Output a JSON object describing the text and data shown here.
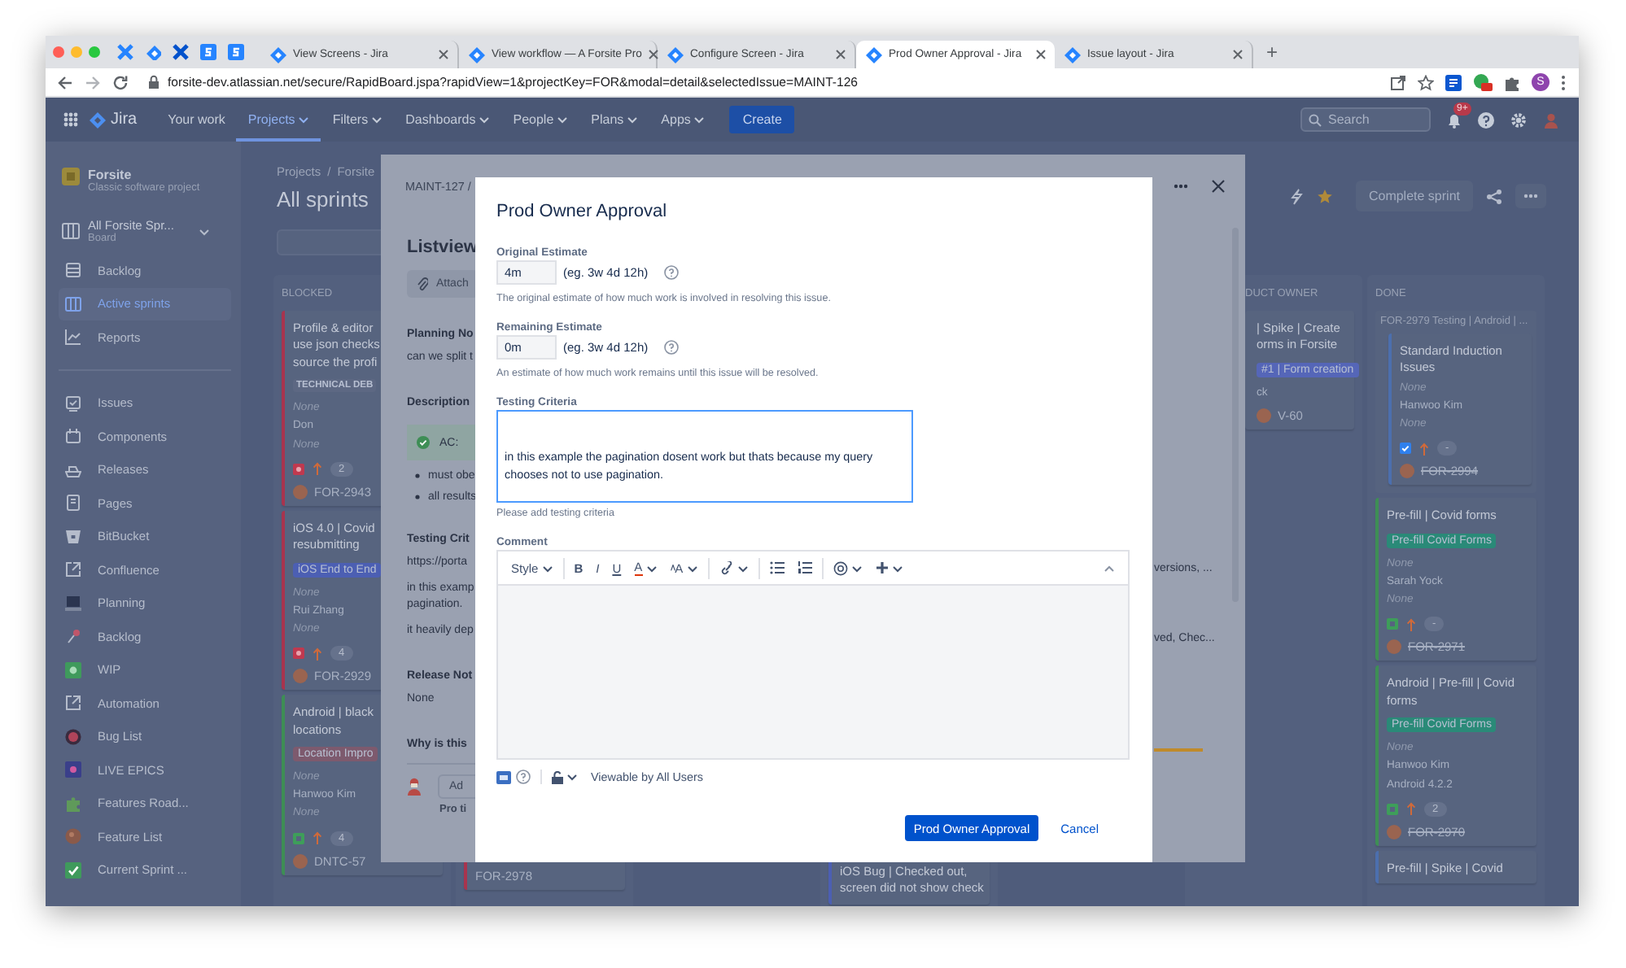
{
  "browser": {
    "tabs": [
      {
        "title": "View Screens - Jira",
        "selected": false
      },
      {
        "title": "View workflow — A Forsite Pro",
        "selected": false
      },
      {
        "title": "Configure Screen - Jira",
        "selected": false
      },
      {
        "title": "Prod Owner Approval - Jira",
        "selected": true
      },
      {
        "title": "Issue layout - Jira",
        "selected": false
      }
    ],
    "new_tab": "+",
    "url": "forsite-dev.atlassian.net/secure/RapidBoard.jspa?rapidView=1&projectKey=FOR&modal=detail&selectedIssue=MAINT-126",
    "profile_initial": "S"
  },
  "nav": {
    "product": "Jira",
    "items": [
      {
        "label": "Your work",
        "selected": false,
        "dropdown": false
      },
      {
        "label": "Projects",
        "selected": true,
        "dropdown": true
      },
      {
        "label": "Filters",
        "selected": false,
        "dropdown": true
      },
      {
        "label": "Dashboards",
        "selected": false,
        "dropdown": true
      },
      {
        "label": "People",
        "selected": false,
        "dropdown": true
      },
      {
        "label": "Plans",
        "selected": false,
        "dropdown": true
      },
      {
        "label": "Apps",
        "selected": false,
        "dropdown": true
      }
    ],
    "create": "Create",
    "search": {
      "placeholder": "Search"
    },
    "notifications": "9+"
  },
  "sidebar": {
    "project": {
      "name": "Forsite",
      "type": "Classic software project"
    },
    "board": {
      "name": "All Forsite Spr...",
      "type": "Board"
    },
    "items": [
      {
        "label": "Backlog",
        "kind": "backlog",
        "selected": false
      },
      {
        "label": "Active sprints",
        "kind": "board",
        "selected": true
      },
      {
        "label": "Reports",
        "kind": "chart",
        "selected": false
      }
    ],
    "shortcuts": [
      {
        "label": "Issues",
        "kind": "issues"
      },
      {
        "label": "Components",
        "kind": "components"
      },
      {
        "label": "Releases",
        "kind": "ship"
      },
      {
        "label": "Pages",
        "kind": "page"
      },
      {
        "label": "BitBucket",
        "kind": "bucket"
      },
      {
        "label": "Confluence",
        "kind": "external"
      },
      {
        "label": "Planning",
        "kind": "laptop"
      },
      {
        "label": "Backlog",
        "kind": "pin"
      },
      {
        "label": "WIP",
        "kind": "green-tile"
      },
      {
        "label": "Automation",
        "kind": "external"
      },
      {
        "label": "Bug List",
        "kind": "red-disc"
      },
      {
        "label": "LIVE EPICS",
        "kind": "purple-tile"
      },
      {
        "label": "Features Road...",
        "kind": "puzzle"
      },
      {
        "label": "Feature List",
        "kind": "brown-disc"
      },
      {
        "label": "Current Sprint ...",
        "kind": "check-tile"
      }
    ]
  },
  "board": {
    "breadcrumb": [
      "Projects",
      "Forsite"
    ],
    "separator": "/",
    "title": "All sprints",
    "complete_sprint": "Complete sprint",
    "columns": [
      {
        "title": "BLOCKED",
        "cards": [
          {
            "summary": "Profile & editor\nuse json checks\nsource the profi",
            "color": "#a8344e",
            "tag": {
              "text": "TECHNICAL DEB",
              "color": "#5d6883"
            },
            "fields": [
              {
                "text": "None",
                "empty": true
              },
              {
                "text": "Don",
                "empty": false
              },
              {
                "text": "None",
                "empty": true
              }
            ],
            "kind": "bug",
            "estimate": "2",
            "key": "FOR-2943",
            "done": false
          },
          {
            "summary": "iOS 4.0 | Covid\nresubmitting",
            "color": "#a8344e",
            "tag": {
              "text": "iOS End to End",
              "color": "#4c5fb3"
            },
            "fields": [
              {
                "text": "None",
                "empty": true
              },
              {
                "text": "Rui Zhang",
                "empty": false
              },
              {
                "text": "None",
                "empty": true
              }
            ],
            "kind": "bug",
            "estimate": "4",
            "key": "FOR-2929",
            "done": false
          },
          {
            "summary": "Android | black\nlocations",
            "color": "#3e8e55",
            "tag": {
              "text": "Location Impro",
              "color": "#7d5a6e"
            },
            "fields": [
              {
                "text": "None",
                "empty": true
              },
              {
                "text": "Hanwoo Kim",
                "empty": false
              },
              {
                "text": "None",
                "empty": true
              }
            ],
            "kind": "story",
            "estimate": "4",
            "key": "DNTC-57",
            "done": false
          }
        ]
      },
      {
        "cards": [
          {
            "color": "#a8344e",
            "key": "FOR-2978",
            "done": false
          }
        ]
      },
      {
        "cards": [
          {
            "summary": "iOS Bug | Checked out,\nscreen did not show check",
            "color": "#4c5fb3"
          }
        ]
      },
      {
        "title": "DUCT OWNER",
        "cards": [
          {
            "summary": "| Spike | Create\norms in Forsite",
            "tag": {
              "text": "#1 | Form creation",
              "color": "#5566b8"
            },
            "fields": [
              {
                "text": "ck",
                "empty": false
              }
            ],
            "key": "V-60",
            "done": false
          }
        ]
      },
      {
        "title": "DONE",
        "group": "FOR-2979 Testing | Android | ...",
        "cards": [
          {
            "summary": "Standard Induction\nIssues",
            "color": "#4c6fae",
            "fields": [
              {
                "text": "None",
                "empty": true
              },
              {
                "text": "Hanwoo Kim",
                "empty": false
              },
              {
                "text": "None",
                "empty": true
              }
            ],
            "kind": "task",
            "estimate": "-",
            "key": "FOR-2994",
            "done": true,
            "in_group": true
          },
          {
            "summary": "Pre-fill | Covid forms",
            "color": "#3e8e55",
            "tag": {
              "text": "Pre-fill Covid Forms",
              "color": "#2a8a78"
            },
            "fields": [
              {
                "text": "None",
                "empty": true
              },
              {
                "text": "Sarah Yock",
                "empty": false
              },
              {
                "text": "None",
                "empty": true
              }
            ],
            "kind": "story",
            "estimate": "-",
            "key": "FOR-2971",
            "done": true
          },
          {
            "summary": "Android | Pre-fill | Covid\nforms",
            "color": "#3e8e55",
            "tag": {
              "text": "Pre-fill Covid Forms",
              "color": "#2a8a78"
            },
            "fields": [
              {
                "text": "None",
                "empty": true
              },
              {
                "text": "Hanwoo Kim",
                "empty": false
              },
              {
                "text": "Android 4.2.2",
                "empty": false
              }
            ],
            "kind": "story",
            "estimate": "2",
            "key": "FOR-2970",
            "done": true
          },
          {
            "summary": "Pre-fill | Spike | Covid",
            "color": "#4c6fae"
          }
        ]
      }
    ]
  },
  "issue_panel": {
    "key": "MAINT-127",
    "separator": "/",
    "title": "Listview",
    "attach": "Attach",
    "content": [
      {
        "kind": "heading",
        "text": "Planning No"
      },
      {
        "kind": "text",
        "text": "can we split t"
      },
      {
        "kind": "heading",
        "text": "Description"
      },
      {
        "kind": "note",
        "text": "AC:"
      },
      {
        "kind": "bullet",
        "text": "must obe"
      },
      {
        "kind": "bullet",
        "text": "all results"
      },
      {
        "kind": "heading",
        "text": "Testing Crit"
      },
      {
        "kind": "text",
        "text": "https://porta"
      },
      {
        "kind": "text",
        "text": "in this examp\npagination."
      },
      {
        "kind": "text",
        "text": "it heavily dep"
      },
      {
        "kind": "heading",
        "text": "Release Not"
      },
      {
        "kind": "text",
        "text": "None"
      },
      {
        "kind": "heading",
        "text": "Why is this"
      }
    ],
    "comment": {
      "placeholder": "Ad"
    },
    "pro_tip": "Pro ti",
    "side": [
      {
        "kind": "text",
        "text": "versions, ..."
      },
      {
        "kind": "text",
        "text": "ved, Chec..."
      },
      {
        "kind": "bar"
      }
    ]
  },
  "modal": {
    "title": "Prod Owner Approval",
    "fields": [
      {
        "kind": "estimate",
        "label": "Original Estimate",
        "value": "4m",
        "hint": "(eg. 3w 4d 12h)",
        "description": "The original estimate of how much work is involved in resolving this issue."
      },
      {
        "kind": "estimate",
        "label": "Remaining Estimate",
        "value": "0m",
        "hint": "(eg. 3w 4d 12h)",
        "description": "An estimate of how much work remains until this issue will be resolved."
      },
      {
        "kind": "textarea",
        "label": "Testing Criteria",
        "value": "\n\nin this example the pagination dosent work but thats because my query chooses not to use pagination.",
        "focused": true,
        "description": "Please add testing criteria"
      },
      {
        "kind": "comment",
        "label": "Comment",
        "toolbar": [
          {
            "kind": "style",
            "label": "Style"
          },
          {
            "kind": "bold",
            "label": "B",
            "separator_before": true
          },
          {
            "kind": "italic",
            "label": "I"
          },
          {
            "kind": "underline",
            "label": "U"
          },
          {
            "kind": "color",
            "label": "A"
          },
          {
            "kind": "size",
            "label": "A"
          },
          {
            "kind": "link",
            "separator_before": true
          },
          {
            "kind": "bullets",
            "separator_before": true
          },
          {
            "kind": "numbers"
          },
          {
            "kind": "mention",
            "separator_before": true
          },
          {
            "kind": "insert"
          },
          {
            "kind": "collapse"
          }
        ],
        "visibility": "Viewable by All Users"
      }
    ],
    "buttons": [
      {
        "kind": "primary",
        "label": "Prod Owner Approval"
      },
      {
        "kind": "link",
        "label": "Cancel"
      }
    ]
  }
}
